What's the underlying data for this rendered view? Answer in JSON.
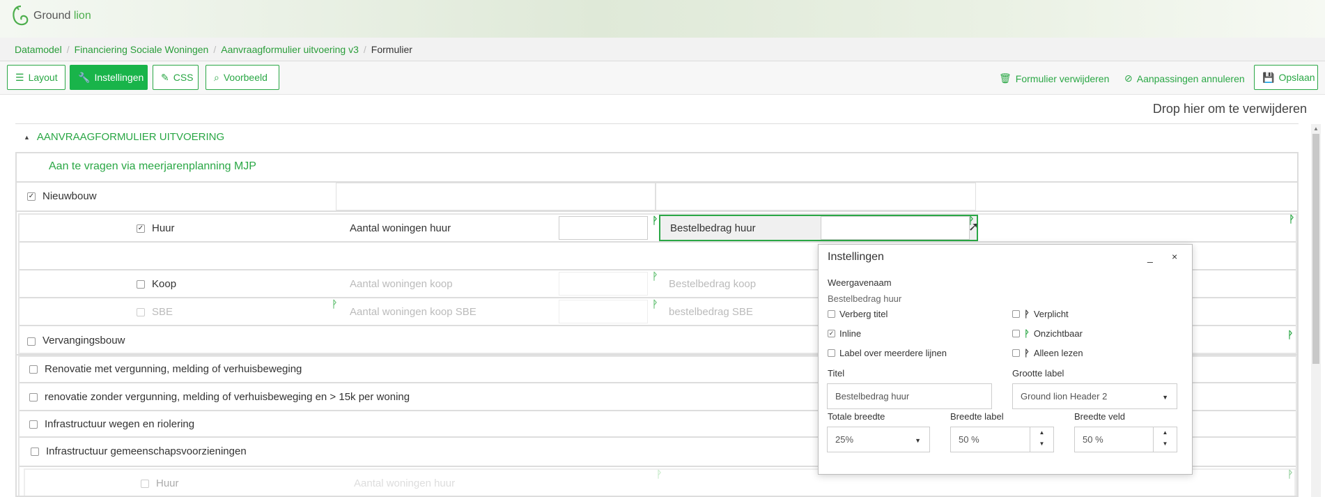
{
  "brand": {
    "name_main": "Ground",
    "name_accent": " lion"
  },
  "breadcrumb": {
    "items": [
      "Datamodel",
      "Financiering Sociale Woningen",
      "Aanvraagformulier uitvoering v3"
    ],
    "current": "Formulier"
  },
  "toolbar": {
    "layout_label": "Layout",
    "instellingen_label": "Instellingen",
    "css_label": "CSS",
    "voorbeeld_label": "Voorbeeld",
    "delete_form_label": "Formulier verwijderen",
    "cancel_changes_label": "Aanpassingen annuleren",
    "save_label": "Opslaan"
  },
  "dropzone_text": "Drop hier om te verwijderen",
  "form": {
    "section_title": "AANVRAAGFORMULIER UITVOERING",
    "subtitle": "Aan te vragen via meerjarenplanning MJP",
    "nieuwbouw": "Nieuwbouw",
    "huur": "Huur",
    "aantal_woningen_huur": "Aantal woningen huur",
    "bestelbedrag_huur": "Bestelbedrag huur",
    "koop": "Koop",
    "aantal_woningen_koop": "Aantal woningen koop",
    "bestelbedrag_koop": "Bestelbedrag koop",
    "sbe": "SBE",
    "aantal_woningen_koop_sbe": "Aantal woningen koop SBE",
    "bestelbedrag_sbe": "bestelbedrag SBE",
    "vervangingsbouw": "Vervangingsbouw",
    "renovatie_met": "Renovatie met vergunning, melding of verhuisbeweging",
    "renovatie_zonder": "renovatie zonder vergunning, melding of verhuisbeweging en > 15k per woning",
    "infra_wegen": "Infrastructuur wegen en riolering",
    "infra_gemeenschap": "Infrastructuur gemeenschapsvoorzieningen",
    "huur_bottom": "Huur",
    "aantal_woningen_huur_bottom": "Aantal woningen huur"
  },
  "dialog": {
    "title": "Instellingen",
    "min_symbol": "_",
    "close_symbol": "×",
    "weergavenaam_label": "Weergavenaam",
    "weergavenaam_value": "Bestelbedrag huur",
    "verberg_titel": "Verberg titel",
    "inline": "Inline",
    "label_meerdere": "Label over meerdere lijnen",
    "verplicht": "Verplicht",
    "onzichtbaar": "Onzichtbaar",
    "alleen_lezen": "Alleen lezen",
    "titel_label": "Titel",
    "titel_value": "Bestelbedrag huur",
    "grootte_label": "Grootte label",
    "grootte_value": "Ground lion Header 2",
    "totale_breedte_label": "Totale breedte",
    "totale_breedte_value": "25%",
    "breedte_label_label": "Breedte label",
    "breedte_label_value": "50 %",
    "breedte_veld_label": "Breedte veld",
    "breedte_veld_value": "50 %"
  },
  "colors": {
    "accent": "#2aa745",
    "primary_button": "#19b44a"
  }
}
